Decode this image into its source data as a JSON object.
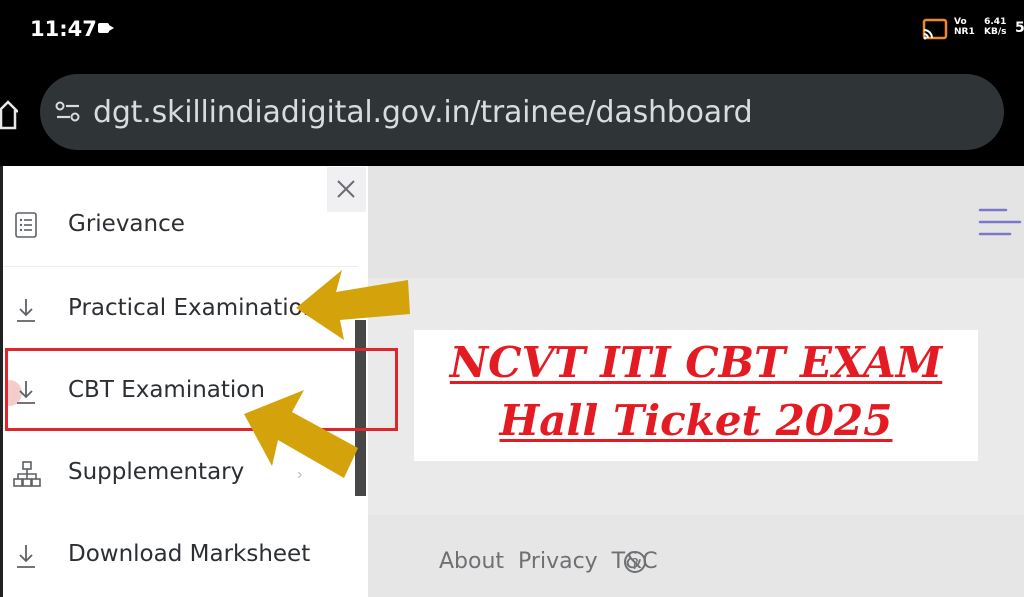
{
  "status_bar": {
    "time": "11:47",
    "network_top": "Vo",
    "network_bottom": "NR1",
    "speed_value": "6.41",
    "speed_unit": "KB/s",
    "battery_partial": "5"
  },
  "browser": {
    "url": "dgt.skillindiadigital.gov.in/trainee/dashboard"
  },
  "sidebar": {
    "items": [
      {
        "label": "Grievance",
        "icon": "list-icon"
      },
      {
        "label": "Practical Examination",
        "icon": "download-icon"
      },
      {
        "label": "CBT Examination",
        "icon": "download-icon"
      },
      {
        "label": "Supplementary",
        "icon": "sitemap-icon"
      },
      {
        "label": "Download Marksheet",
        "icon": "download-icon"
      }
    ]
  },
  "footer": {
    "links": "About  Privacy  T&C",
    "help_glyph": "?"
  },
  "overlay": {
    "line1": "NCVT ITI CBT EXAM",
    "line2": "Hall Ticket 2025"
  },
  "colors": {
    "highlight_box": "#e0262b",
    "overlay_text": "#e41b23",
    "arrow": "#d4a20a"
  }
}
